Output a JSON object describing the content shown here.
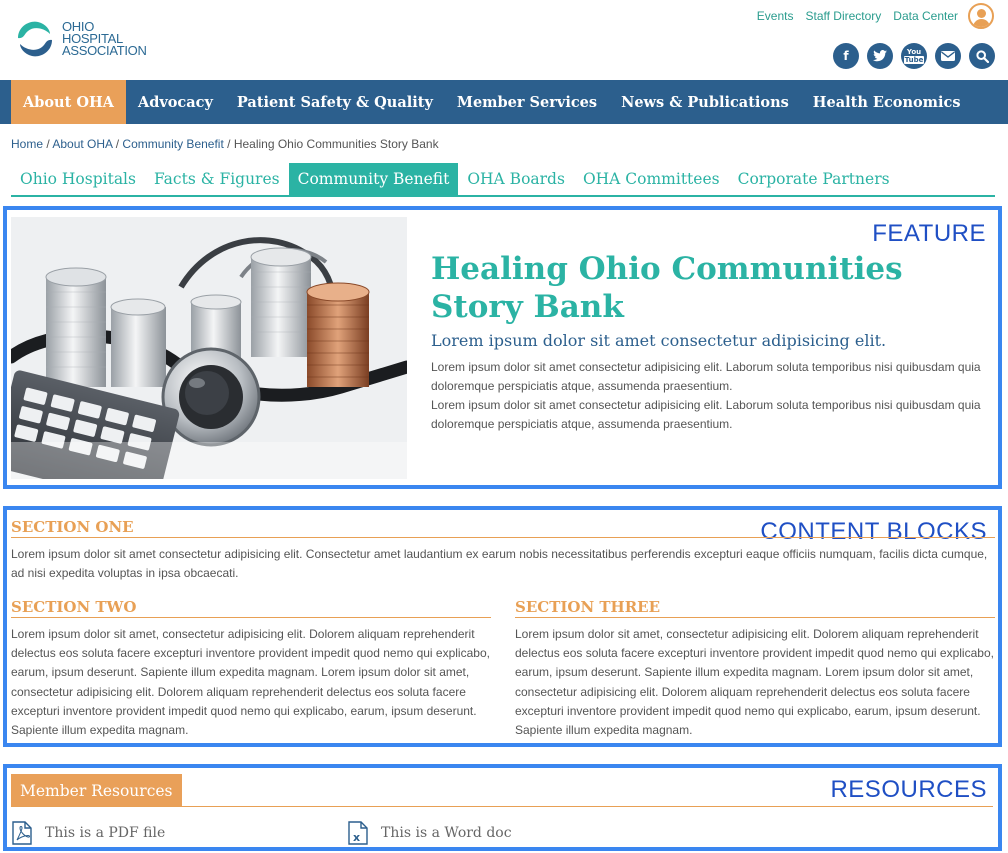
{
  "header": {
    "logo_text": [
      "Ohio",
      "Hospital",
      "Association"
    ],
    "util_links": [
      "Events",
      "Staff Directory",
      "Data Center"
    ],
    "social_icons": [
      "facebook-icon",
      "twitter-icon",
      "youtube-icon",
      "email-icon",
      "search-icon"
    ]
  },
  "nav": {
    "items": [
      "About OHA",
      "Advocacy",
      "Patient Safety & Quality",
      "Member Services",
      "News & Publications",
      "Health Economics"
    ],
    "active": "About OHA"
  },
  "breadcrumb": {
    "items": [
      "Home",
      "About OHA",
      "Community Benefit"
    ],
    "current": "Healing Ohio Communities Story Bank",
    "separator": " / "
  },
  "subnav": {
    "tabs": [
      "Ohio Hospitals",
      "Facts & Figures",
      "Community Benefit",
      "OHA Boards",
      "OHA Committees",
      "Corporate Partners"
    ],
    "active": "Community Benefit"
  },
  "annotations": {
    "feature": "FEATURE",
    "content_blocks": "CONTENT BLOCKS",
    "resources": "RESOURCES"
  },
  "feature": {
    "title": "Healing Ohio Communities Story Bank",
    "subtitle": "Lorem ipsum dolor sit amet consectetur adipisicing elit.",
    "paragraph1": "Lorem ipsum dolor sit amet consectetur adipisicing elit. Laborum soluta temporibus nisi quibusdam quia doloremque perspiciatis atque, assumenda praesentium.",
    "paragraph2": "Lorem ipsum dolor sit amet consectetur adipisicing elit. Laborum soluta temporibus nisi quibusdam quia doloremque perspiciatis atque, assumenda praesentium."
  },
  "sections": {
    "one": {
      "heading": "SECTION ONE",
      "text": "Lorem ipsum dolor sit amet consectetur adipisicing elit. Consectetur amet laudantium ex earum nobis necessitatibus perferendis excepturi eaque officiis numquam, facilis dicta cumque, ad nisi expedita voluptas in ipsa obcaecati."
    },
    "two": {
      "heading": "SECTION TWO",
      "text": "Lorem ipsum dolor sit amet, consectetur adipisicing elit. Dolorem aliquam reprehenderit delectus eos soluta facere excepturi inventore provident impedit quod nemo qui explicabo, earum, ipsum deserunt. Sapiente illum expedita magnam. Lorem ipsum dolor sit amet, consectetur adipisicing elit. Dolorem aliquam reprehenderit delectus eos soluta facere excepturi inventore provident impedit quod nemo qui explicabo, earum, ipsum deserunt. Sapiente illum expedita magnam."
    },
    "three": {
      "heading": "SECTION THREE",
      "text": "Lorem ipsum dolor sit amet, consectetur adipisicing elit. Dolorem aliquam reprehenderit delectus eos soluta facere excepturi inventore provident impedit quod nemo qui explicabo, earum, ipsum deserunt. Sapiente illum expedita magnam. Lorem ipsum dolor sit amet, consectetur adipisicing elit. Dolorem aliquam reprehenderit delectus eos soluta facere excepturi inventore provident impedit quod nemo qui explicabo, earum, ipsum deserunt. Sapiente illum expedita magnam."
    }
  },
  "resources": {
    "heading": "Member Resources",
    "items": [
      {
        "label": "This is a PDF file",
        "icon": "pdf-file-icon"
      },
      {
        "label": "This is a Word doc",
        "icon": "word-doc-icon"
      }
    ]
  },
  "colors": {
    "navy": "#2c5f8d",
    "teal": "#2bb3a4",
    "orange": "#e9a059",
    "annotation_blue": "#3a86f0"
  }
}
